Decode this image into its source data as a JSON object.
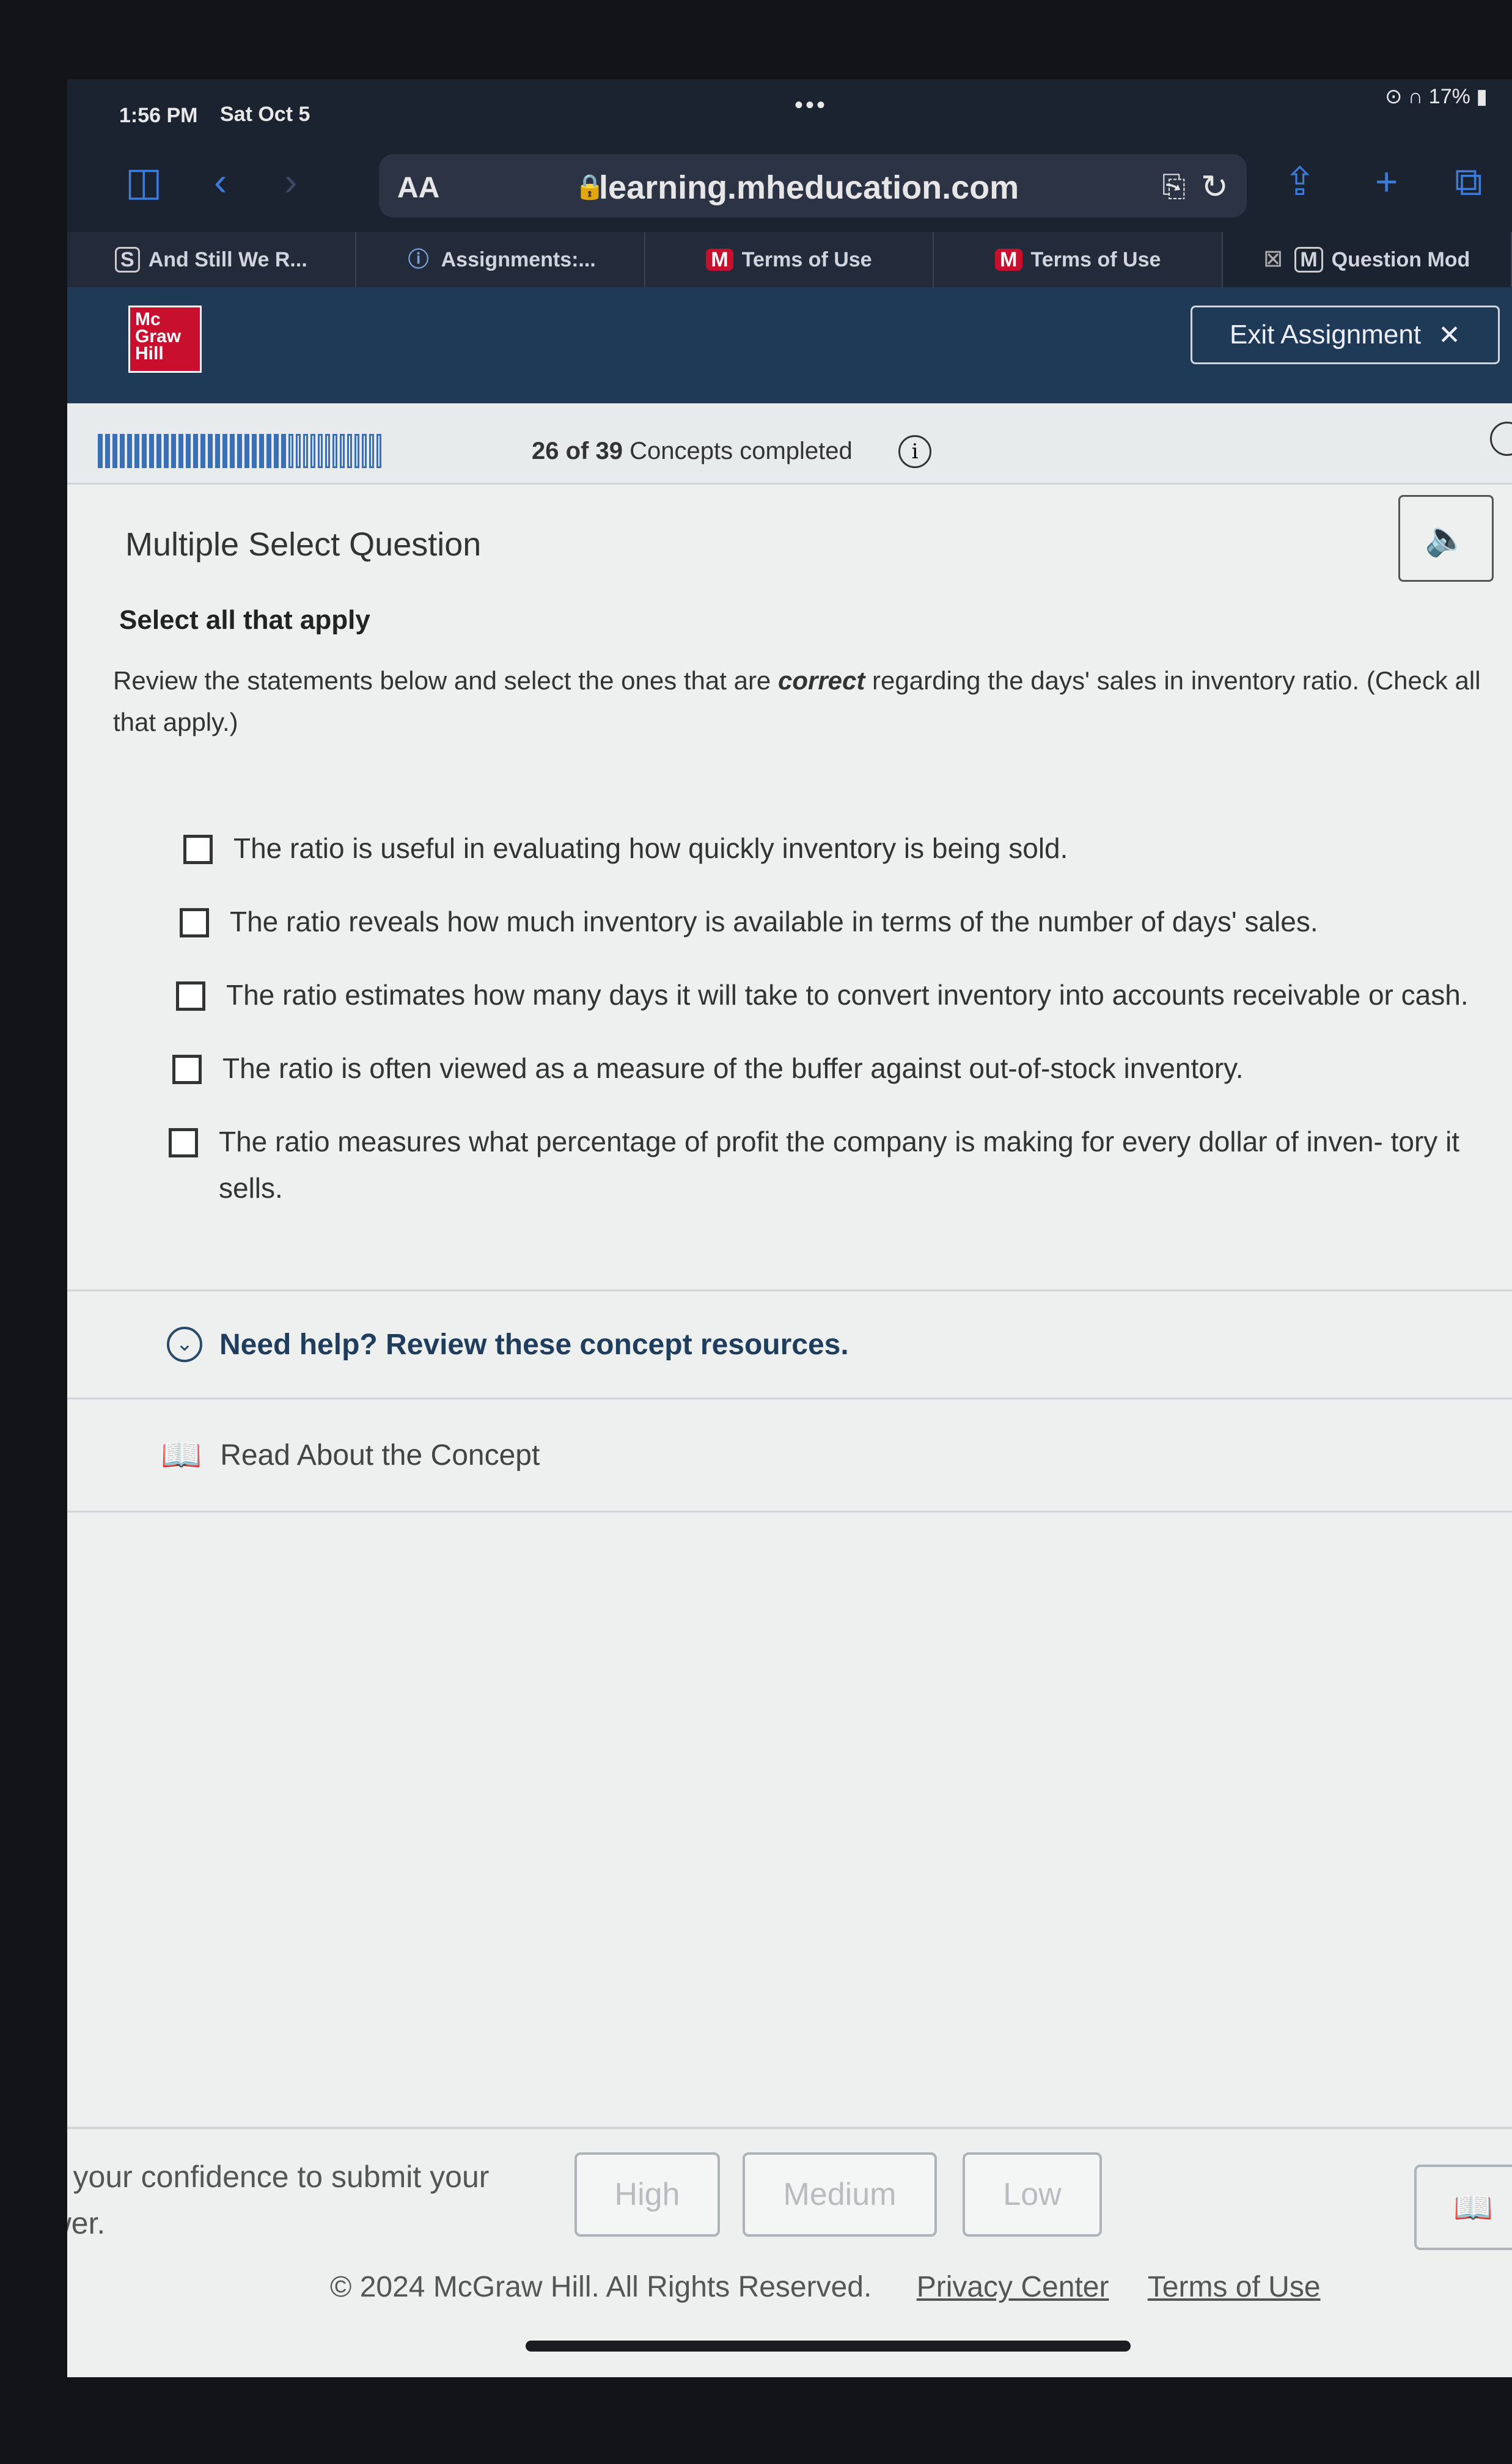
{
  "status": {
    "time": "1:56 PM",
    "date": "Sat Oct 5",
    "battery": "17%"
  },
  "browser": {
    "aa_label": "AA",
    "url": "learning.mheducation.com",
    "tabs": [
      {
        "icon": "S",
        "label": "And Still We R..."
      },
      {
        "icon": "ⓘ",
        "label": "Assignments:..."
      },
      {
        "icon": "M",
        "label": "Terms of Use"
      },
      {
        "icon": "M",
        "label": "Terms of Use"
      },
      {
        "icon": "M",
        "label": "Question Mod"
      }
    ]
  },
  "header": {
    "logo": "Mc Graw Hill",
    "exit_label": "Exit Assignment"
  },
  "progress": {
    "completed": 26,
    "total": 39,
    "count_text": "26 of 39",
    "label_text": "Concepts completed"
  },
  "question": {
    "type": "Multiple Select Question",
    "instruction": "Select all that apply",
    "prompt_before": "Review the statements below and select the ones that are ",
    "prompt_emph": "correct",
    "prompt_after": " regarding the days' sales in inventory ratio. (Check all that apply.)",
    "options": [
      "The ratio is useful in evaluating how quickly inventory is being sold.",
      "The ratio reveals how much inventory is available in terms of the number of days' sales.",
      "The ratio estimates how many days it will take to convert inventory into accounts receivable or cash.",
      "The ratio is often viewed as a measure of the buffer against out-of-stock inventory.",
      "The ratio measures what percentage of profit the company is making for every dollar of inven- tory it sells."
    ]
  },
  "help": {
    "title": "Need help? Review these concept resources.",
    "read_concept": "Read About the Concept"
  },
  "confidence": {
    "label": "Rate your confidence to submit your answer.",
    "high": "High",
    "medium": "Medium",
    "low": "Low"
  },
  "footer": {
    "copyright": "© 2024 McGraw Hill. All Rights Reserved.",
    "privacy": "Privacy Center",
    "terms": "Terms of Use"
  }
}
